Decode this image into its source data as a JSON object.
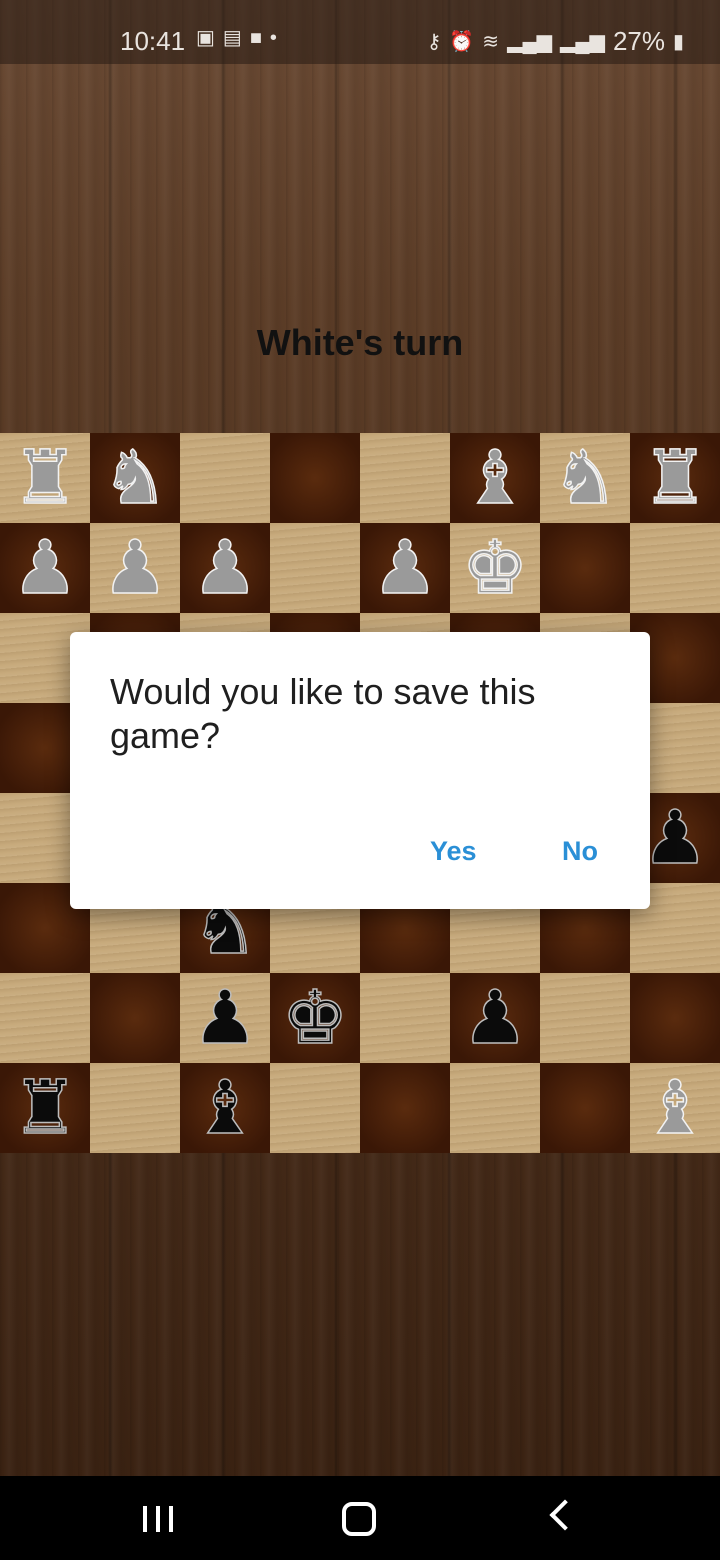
{
  "status_bar": {
    "time": "10:41",
    "battery": "27%",
    "left_icons": [
      "gallery-icon",
      "calendar-icon",
      "video-icon",
      "dot-icon"
    ],
    "right_icons": [
      "key-icon",
      "alarm-icon",
      "wifi-icon",
      "signal-icon",
      "signal-icon",
      "battery-icon"
    ]
  },
  "game": {
    "turn_label": "White's turn"
  },
  "board": {
    "light_color": "#c7aa7c",
    "dark_color": "#3a1706",
    "rows": [
      [
        "wr",
        "wn",
        "",
        "",
        "",
        "wb",
        "wn",
        "wr"
      ],
      [
        "wp",
        "wp",
        "wp",
        "",
        "wp",
        "wk",
        "",
        ""
      ],
      [
        "",
        "",
        "",
        "",
        "",
        "",
        "",
        ""
      ],
      [
        "",
        "",
        "",
        "",
        "",
        "",
        "",
        ""
      ],
      [
        "",
        "",
        "",
        "",
        "",
        "",
        "",
        "bp"
      ],
      [
        "",
        "",
        "bn",
        "",
        "",
        "",
        "",
        ""
      ],
      [
        "",
        "",
        "bp",
        "bk",
        "",
        "bp",
        "",
        ""
      ],
      [
        "br",
        "",
        "bb",
        "",
        "",
        "",
        "",
        "wb"
      ]
    ],
    "glyphs": {
      "wk": "♚",
      "wq": "♛",
      "wr": "♜",
      "wb": "♝",
      "wn": "♞",
      "wp": "♟",
      "bk": "♚",
      "bq": "♛",
      "br": "♜",
      "bb": "♝",
      "bn": "♞",
      "bp": "♟"
    }
  },
  "dialog": {
    "message": "Would you like to save this game?",
    "yes_label": "Yes",
    "no_label": "No",
    "accent_color": "#2a8fd6"
  },
  "navbar": {
    "buttons": [
      "recent-apps-icon",
      "home-icon",
      "back-icon"
    ]
  }
}
